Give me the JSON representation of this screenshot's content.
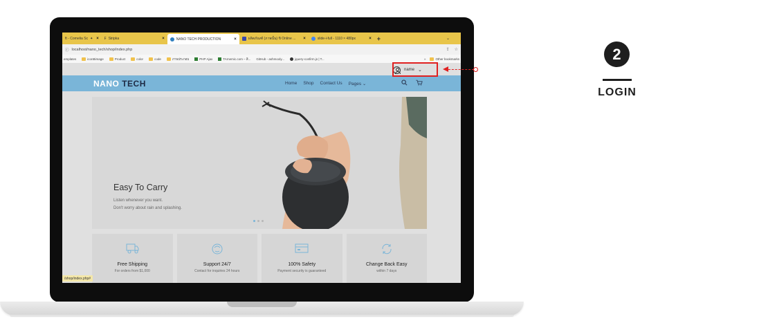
{
  "browser": {
    "tabs": [
      {
        "label": "ft - Cornelia Sc",
        "active": false
      },
      {
        "label": "Stripka",
        "active": false
      },
      {
        "label": "NANO TECH PRODUCTION",
        "active": true
      },
      {
        "label": "ผลิตภัณฑ์ (ภาพนั้น) ขิ Online ...",
        "active": false
      },
      {
        "label": "slide-i-full - 1110 × 480px",
        "active": false
      }
    ],
    "add_tab": "+",
    "url": "localhost/nano_tech/shop/index.php",
    "bookmarks": [
      "emplates",
      "iconBimage",
      "Product",
      "color",
      "code",
      "ภาพประกอบ",
      "PHP Ajax",
      "TArnemic.com – สิ...",
      "GitHub - ashmooly...",
      "jquery-confirm.js | T..."
    ],
    "other_bookmarks": "Other bookmarks",
    "status_link": "/shop/index.php#"
  },
  "site": {
    "user_name": "name",
    "brand_part1": "NANO",
    "brand_part2": "TECH",
    "nav": [
      "Home",
      "Shop",
      "Contact Us",
      "Pages"
    ],
    "hero": {
      "title": "Easy To Carry",
      "subtitle1": "Listen whenever you want.",
      "subtitle2": "Don't worry about rain and splashing."
    },
    "features": [
      {
        "title": "Free Shipping",
        "sub": "For orders from $1,000",
        "icon": "truck-icon"
      },
      {
        "title": "Support 24/7",
        "sub": "Contact for inquiries 24 hours",
        "icon": "support-icon"
      },
      {
        "title": "100% Safety",
        "sub": "Payment security is guaranteed",
        "icon": "credit-card-icon"
      },
      {
        "title": "Change Back Easy",
        "sub": "within 7 days",
        "icon": "refresh-icon"
      }
    ]
  },
  "step": {
    "number": "2",
    "label": "LOGIN"
  },
  "colors": {
    "navbar": "#7ab5d8",
    "highlight": "#e02020",
    "tabbar": "#e8c54a"
  }
}
